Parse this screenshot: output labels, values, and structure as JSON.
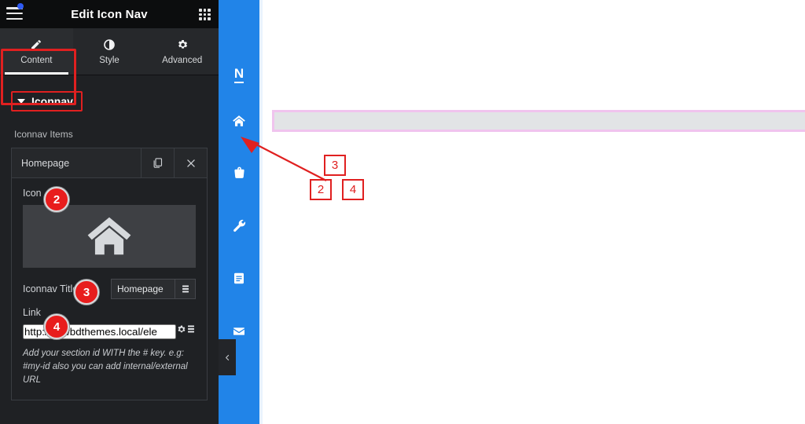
{
  "panel": {
    "title": "Edit Icon Nav",
    "menu_icon": "hamburger-icon",
    "apps_icon": "grid-apps-icon",
    "tabs": [
      {
        "label": "Content",
        "icon": "pencil-icon",
        "active": true
      },
      {
        "label": "Style",
        "icon": "contrast-half-circle-icon",
        "active": false
      },
      {
        "label": "Advanced",
        "icon": "gear-icon",
        "active": false
      }
    ],
    "section": {
      "label": "Iconnav",
      "expanded": true,
      "caret": "caret-down-icon"
    },
    "items_label": "Iconnav Items",
    "repeater_item": {
      "title": "Homepage",
      "duplicate_icon": "copy-icon",
      "remove_icon": "close-x-icon"
    },
    "fields": {
      "icon_label": "Icon",
      "icon_preview": "home-icon",
      "title_label": "Iconnav Title",
      "title_value": "Homepage",
      "title_dynamic_icon": "database-stack-icon",
      "link_label": "Link",
      "link_value": "http://newbdthemes.local/ele",
      "link_settings_icon": "gear-icon",
      "link_dynamic_icon": "database-stack-icon",
      "link_help": "Add your section id WITH the # key. e.g: #my-id also you can add internal/external URL"
    }
  },
  "nav": {
    "items": [
      {
        "icon": "letter-n-logo",
        "label": "N"
      },
      {
        "icon": "home-icon",
        "label": ""
      },
      {
        "icon": "briefcase-bag-icon",
        "label": ""
      },
      {
        "icon": "wrench-icon",
        "label": ""
      },
      {
        "icon": "book-document-icon",
        "label": ""
      },
      {
        "icon": "envelope-mail-icon",
        "label": ""
      }
    ],
    "collapse_icon": "chevron-left-icon"
  },
  "annotations": {
    "badges": [
      {
        "number": "2",
        "target": "icon-field"
      },
      {
        "number": "3",
        "target": "iconnav-title-field"
      },
      {
        "number": "4",
        "target": "link-field"
      }
    ],
    "canvas_boxes": [
      {
        "number": "3"
      },
      {
        "number": "2"
      },
      {
        "number": "4"
      }
    ],
    "arrow": "red-arrow-pointing-to-home-icon",
    "highlight_color": "#e02020",
    "badge_color": "#e81d1d"
  },
  "canvas": {
    "placeholder_bar": "empty-section-placeholder",
    "accent_color": "#2184e8",
    "bar_border_color": "#f0c4ee"
  }
}
